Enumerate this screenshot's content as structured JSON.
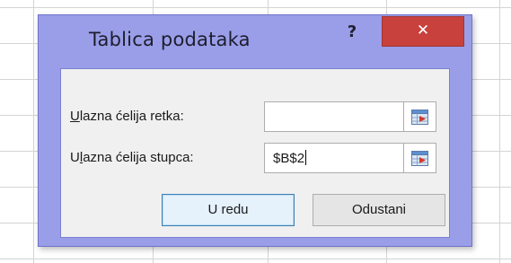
{
  "dialog": {
    "title": "Tablica podataka",
    "help_label": "?",
    "close_label": "✕",
    "row_input": {
      "label_access_key": "U",
      "label_rest": "lazna ćelija retka:",
      "value": ""
    },
    "column_input": {
      "label_prefix": "U",
      "label_access_key": "l",
      "label_rest": "azna ćelija stupca:",
      "value": "$B$2"
    },
    "ok_label": "U redu",
    "cancel_label": "Odustani",
    "collapse_icon": "range-select-icon"
  },
  "colors": {
    "frame": "#9a9ee8",
    "close": "#c8413d",
    "content_bg": "#f0f0f0"
  }
}
